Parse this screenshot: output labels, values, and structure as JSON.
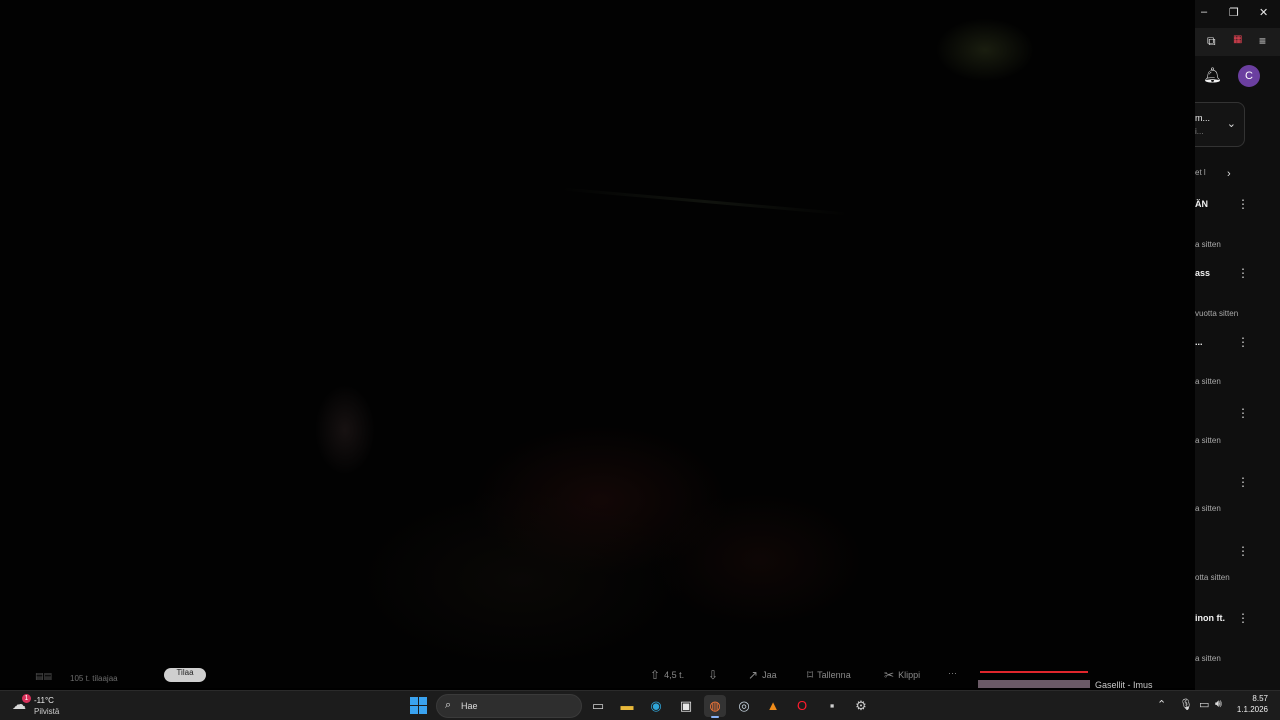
{
  "video": {
    "channel": {
      "subscribers": "105 t. tilaajaa",
      "join_label": "Tilaa"
    },
    "actions": [
      {
        "name": "like",
        "icon": "thumb-up-icon",
        "label": "4,5 t."
      },
      {
        "name": "dislike",
        "icon": "thumb-down-icon",
        "label": ""
      },
      {
        "name": "share",
        "icon": "share-icon",
        "label": "Jaa"
      },
      {
        "name": "save",
        "icon": "bookmark-icon",
        "label": "Tallenna"
      },
      {
        "name": "clip",
        "icon": "scissors-icon",
        "label": "Klippi"
      },
      {
        "name": "more",
        "icon": "more-horizontal-icon",
        "label": "···"
      }
    ],
    "next_title": "Gasellit - Imus",
    "accent": "#e0262c"
  },
  "window": {
    "minimize": "–",
    "restore": "❐",
    "close": "✕"
  },
  "browser": {
    "extensions_icon": "puzzle-icon",
    "menu_icon": "hamburger-icon"
  },
  "youtube": {
    "bell_icon": "bell-icon",
    "avatar_letter": "C",
    "avatar_color": "#6b3fa0",
    "playlist": {
      "line1": "m...",
      "line2": "i..."
    },
    "chip": "et l",
    "recommendations": [
      {
        "title": "ÄN",
        "meta": "a sitten"
      },
      {
        "title": "ass",
        "meta": "vuotta sitten"
      },
      {
        "title": "...",
        "meta": "a sitten"
      },
      {
        "title": "",
        "meta": "a sitten"
      },
      {
        "title": "",
        "meta": "a sitten"
      },
      {
        "title": "",
        "meta": "otta sitten"
      },
      {
        "title": "inon ft.",
        "meta": "a sitten"
      }
    ]
  },
  "taskbar": {
    "weather": {
      "temp": "-11°C",
      "condition": "Pilvistä",
      "badge": "1"
    },
    "search_placeholder": "Hae",
    "apps": [
      {
        "name": "task-view",
        "icon": "task-view-icon",
        "glyph": "▭",
        "color": "#cfcfcf"
      },
      {
        "name": "file-explorer",
        "icon": "folder-icon",
        "glyph": "▬",
        "color": "#e8b83a"
      },
      {
        "name": "edge",
        "icon": "edge-icon",
        "glyph": "◉",
        "color": "#2fa5d8"
      },
      {
        "name": "microsoft-store",
        "icon": "store-icon",
        "glyph": "▣",
        "color": "#e8e8e8"
      },
      {
        "name": "firefox",
        "icon": "firefox-icon",
        "glyph": "◍",
        "color": "#ff7b39"
      },
      {
        "name": "steam",
        "icon": "steam-icon",
        "glyph": "◎",
        "color": "#c7d5e0"
      },
      {
        "name": "vlc",
        "icon": "vlc-icon",
        "glyph": "▲",
        "color": "#f08c1a"
      },
      {
        "name": "opera",
        "icon": "opera-icon",
        "glyph": "O",
        "color": "#ff1b2d"
      },
      {
        "name": "terminal",
        "icon": "terminal-icon",
        "glyph": "▪",
        "color": "#cfcfcf"
      },
      {
        "name": "settings",
        "icon": "gear-icon",
        "glyph": "⚙",
        "color": "#cfcfcf"
      }
    ],
    "clock": {
      "time": "8.57",
      "date": "1.1.2026"
    }
  }
}
